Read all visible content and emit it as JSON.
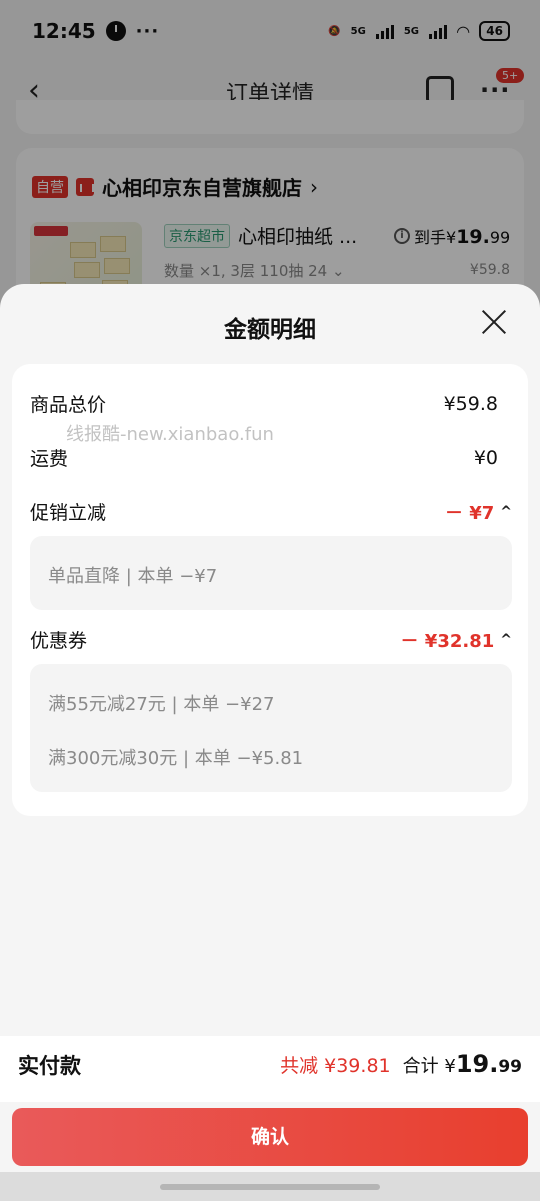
{
  "status_bar": {
    "time": "12:45",
    "dots": "···",
    "net1": "5G",
    "net2": "5G",
    "battery": "46"
  },
  "nav": {
    "back": "‹",
    "title": "订单详情",
    "more": "···",
    "badge": "5+"
  },
  "shop": {
    "tag": "自营",
    "name": "心相印京东自营旗舰店",
    "arrow": "›",
    "product": {
      "tag": "京东超市",
      "name": "心相印抽纸 ...",
      "spec": "数量 ×1, 3层 110抽 24 ⌄",
      "price_prefix": "到手¥",
      "price_int": "19.",
      "price_dec": "99",
      "original": "¥59.8"
    }
  },
  "sheet": {
    "title": "金额明细",
    "watermark": "线报酷-new.xianbao.fun",
    "rows": {
      "total": {
        "label": "商品总价",
        "value": "¥59.8"
      },
      "shipping": {
        "label": "运费",
        "value": "¥0"
      },
      "promo": {
        "label": "促销立减",
        "value": "－ ¥7",
        "caret": "^"
      },
      "coupon": {
        "label": "优惠券",
        "value": "－ ¥32.81",
        "caret": "^"
      }
    },
    "promo_items": [
      "单品直降 | 本单 −¥7"
    ],
    "coupon_items": [
      "满55元减27元 | 本单 −¥27",
      "满300元减30元 | 本单 −¥5.81"
    ]
  },
  "pay": {
    "label": "实付款",
    "reduce": "共减 ¥39.81",
    "total_prefix": "合计 ¥",
    "total_int": "19.",
    "total_dec": "99"
  },
  "confirm_label": "确认",
  "colors": {
    "accent": "#e0332b",
    "button_start": "#e95a5a",
    "button_end": "#e83f2e"
  }
}
